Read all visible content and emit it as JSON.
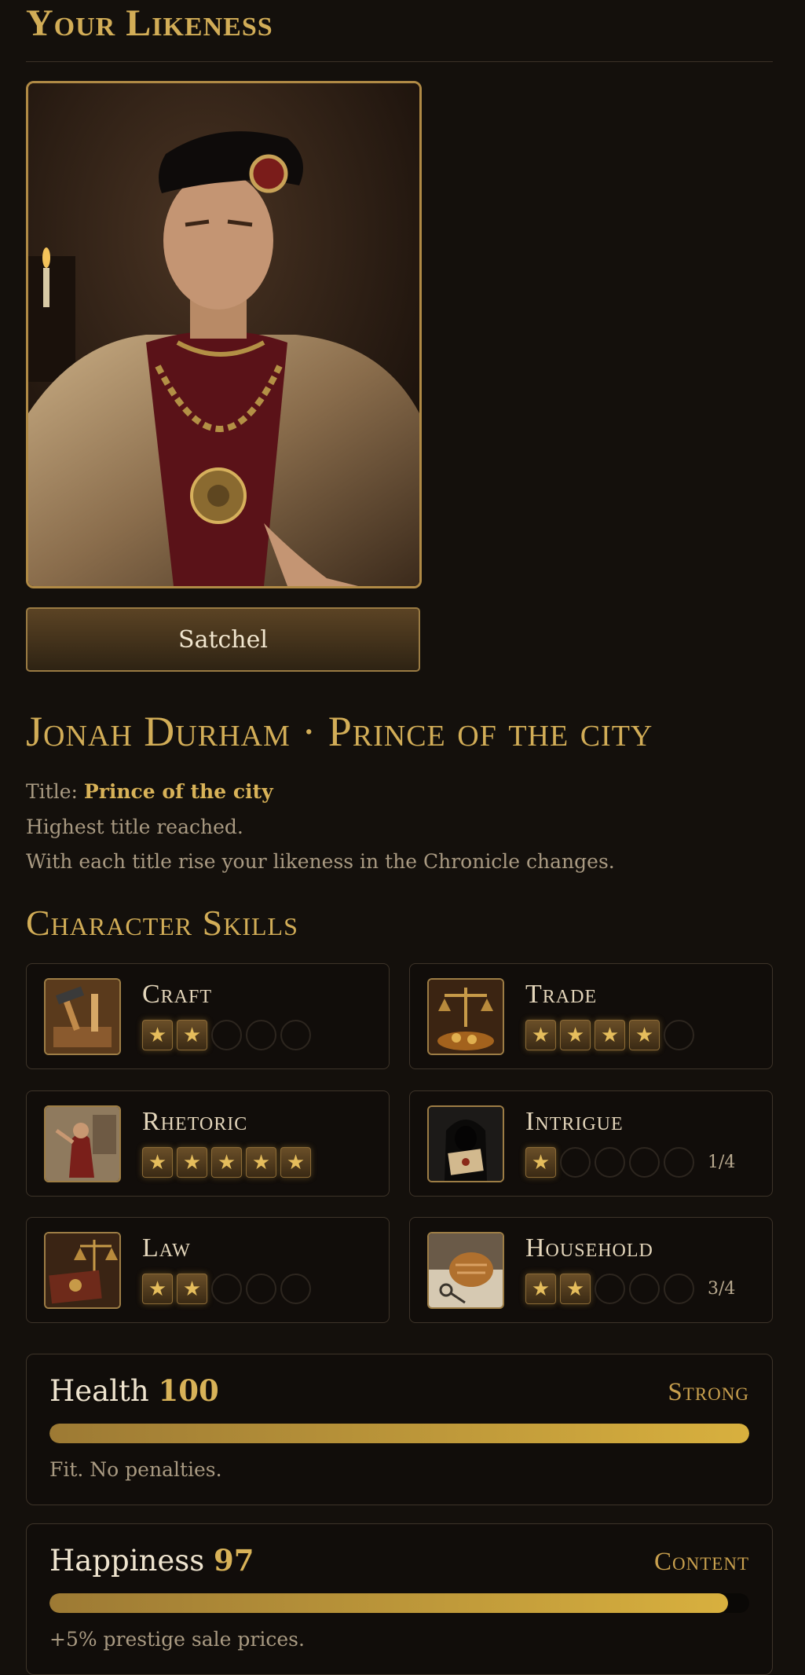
{
  "header": {
    "title": "Your Likeness"
  },
  "portrait": {
    "alt": "Portrait of Jonah Durham"
  },
  "satchel_label": "Satchel",
  "character": {
    "name_line": "Jonah Durham · Prince of the city",
    "title_label": "Title:",
    "title_value": "Prince of the city",
    "line1": "Highest title reached.",
    "line2": "With each title rise your likeness in the Chronicle changes."
  },
  "skills_title": "Character Skills",
  "skills": [
    {
      "name": "Craft",
      "icon": "hammer-chisel-icon",
      "level": 2,
      "max": 5,
      "progress": ""
    },
    {
      "name": "Trade",
      "icon": "scales-coins-icon",
      "level": 4,
      "max": 5,
      "progress": ""
    },
    {
      "name": "Rhetoric",
      "icon": "orator-icon",
      "level": 5,
      "max": 5,
      "progress": ""
    },
    {
      "name": "Intrigue",
      "icon": "hooded-letter-icon",
      "level": 1,
      "max": 5,
      "progress": "1/4"
    },
    {
      "name": "Law",
      "icon": "law-book-scales-icon",
      "level": 2,
      "max": 5,
      "progress": ""
    },
    {
      "name": "Household",
      "icon": "bread-keys-icon",
      "level": 2,
      "max": 5,
      "progress": "3/4"
    }
  ],
  "health": {
    "label": "Health",
    "value": "100",
    "fraction": 1.0,
    "state": "Strong",
    "desc": "Fit. No penalties."
  },
  "happiness": {
    "label": "Happiness",
    "value": "97",
    "fraction": 0.97,
    "state": "Content",
    "desc": "+5% prestige sale prices."
  },
  "colors": {
    "accent": "#d2ad57",
    "background": "#14100c",
    "bar_fill": "#d8b03e"
  }
}
